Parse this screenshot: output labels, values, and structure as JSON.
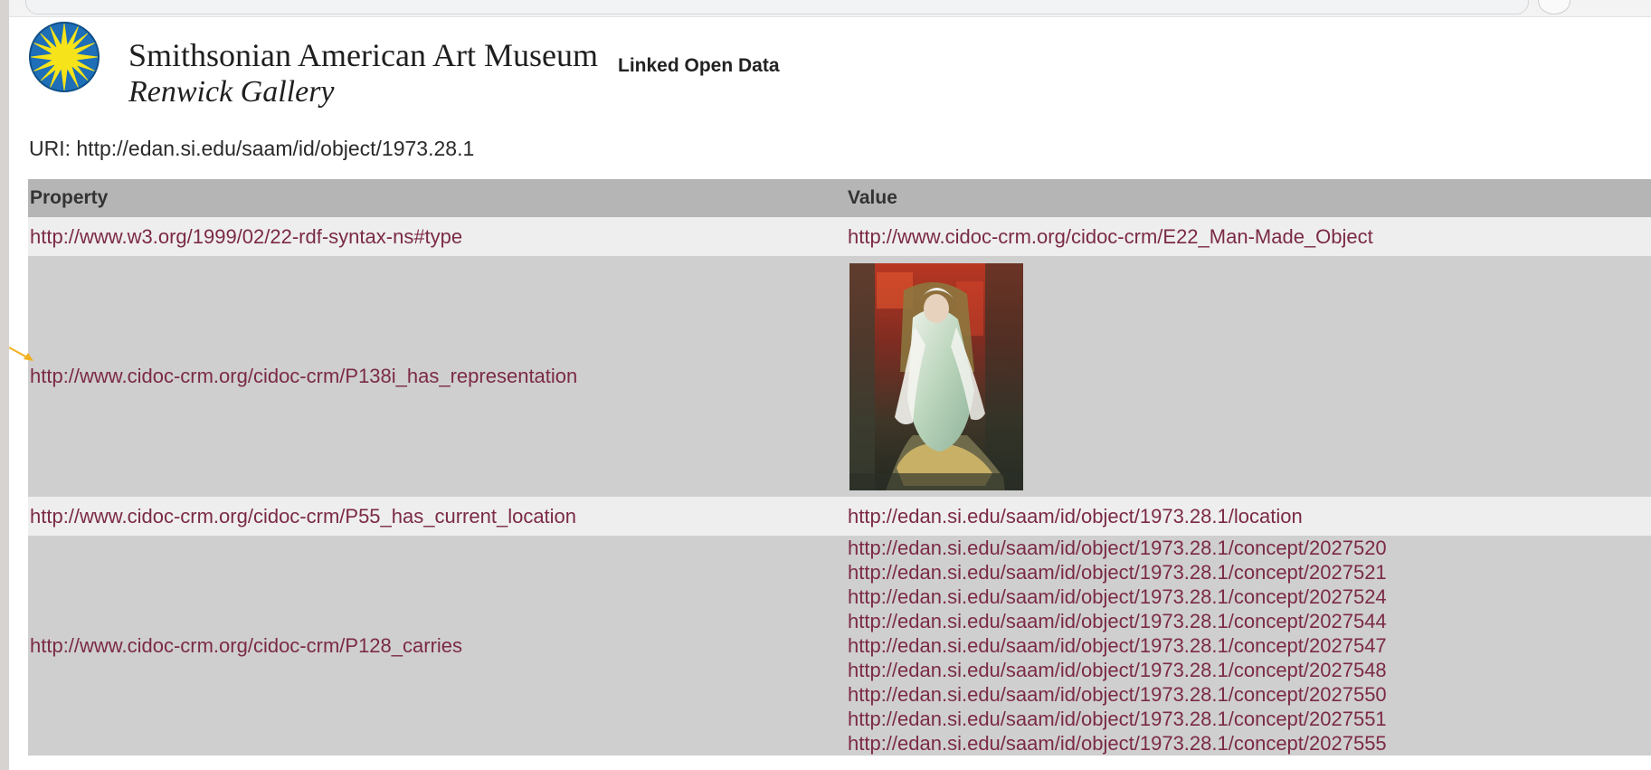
{
  "header": {
    "museum_name": "Smithsonian American Art Museum",
    "gallery_name": "Renwick Gallery",
    "tag": "Linked Open Data"
  },
  "uri": {
    "text": "URI: http://edan.si.edu/saam/id/object/1973.28.1"
  },
  "table": {
    "headers": [
      "Property",
      "Value"
    ],
    "rows": [
      {
        "property": "http://www.w3.org/1999/02/22-rdf-syntax-ns#type",
        "values": [
          "http://www.cidoc-crm.org/cidoc-crm/E22_Man-Made_Object"
        ]
      },
      {
        "property": "http://www.cidoc-crm.org/cidoc-crm/P138i_has_representation",
        "image": "artwork-thumbnail"
      },
      {
        "property": "http://www.cidoc-crm.org/cidoc-crm/P55_has_current_location",
        "values": [
          "http://edan.si.edu/saam/id/object/1973.28.1/location"
        ]
      },
      {
        "property": "http://www.cidoc-crm.org/cidoc-crm/P128_carries",
        "values": [
          "http://edan.si.edu/saam/id/object/1973.28.1/concept/2027520",
          "http://edan.si.edu/saam/id/object/1973.28.1/concept/2027521",
          "http://edan.si.edu/saam/id/object/1973.28.1/concept/2027524",
          "http://edan.si.edu/saam/id/object/1973.28.1/concept/2027544",
          "http://edan.si.edu/saam/id/object/1973.28.1/concept/2027547",
          "http://edan.si.edu/saam/id/object/1973.28.1/concept/2027548",
          "http://edan.si.edu/saam/id/object/1973.28.1/concept/2027550",
          "http://edan.si.edu/saam/id/object/1973.28.1/concept/2027551",
          "http://edan.si.edu/saam/id/object/1973.28.1/concept/2027555"
        ]
      }
    ]
  },
  "colors": {
    "link": "#7b2a46",
    "header_row": "#b5b5b5",
    "row_light": "#eeeeee",
    "row_dark": "#cfcfcf",
    "logo_sun": "#f7e319",
    "logo_sky": "#1e6fb7",
    "annotation": "#f1b01c"
  }
}
